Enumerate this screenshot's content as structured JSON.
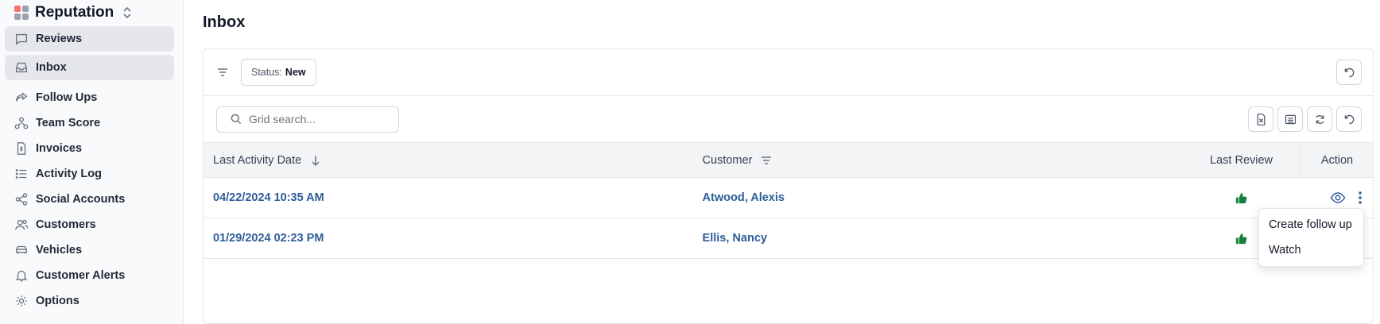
{
  "sidebar": {
    "brand": "Reputation",
    "items": [
      {
        "label": "Reviews",
        "icon": "message-square-icon",
        "active": true
      },
      {
        "label": "Inbox",
        "icon": "inbox-icon",
        "active": true
      },
      {
        "label": "Follow Ups",
        "icon": "share-icon"
      },
      {
        "label": "Team Score",
        "icon": "network-icon"
      },
      {
        "label": "Invoices",
        "icon": "file-dollar-icon"
      },
      {
        "label": "Activity Log",
        "icon": "list-icon"
      },
      {
        "label": "Social Accounts",
        "icon": "share-nodes-icon"
      },
      {
        "label": "Customers",
        "icon": "users-icon"
      },
      {
        "label": "Vehicles",
        "icon": "car-icon"
      },
      {
        "label": "Customer Alerts",
        "icon": "bell-icon"
      },
      {
        "label": "Options",
        "icon": "gear-icon"
      }
    ]
  },
  "page": {
    "title": "Inbox"
  },
  "filter": {
    "status_label": "Status:",
    "status_value": "New"
  },
  "search": {
    "placeholder": "Grid search..."
  },
  "table": {
    "columns": [
      "Last Activity Date",
      "Customer",
      "Last Review",
      "Action"
    ],
    "rows": [
      {
        "date": "04/22/2024 10:35 AM",
        "customer": "Atwood, Alexis",
        "review": "thumbs-up"
      },
      {
        "date": "01/29/2024 02:23 PM",
        "customer": "Ellis, Nancy",
        "review": "thumbs-up"
      }
    ]
  },
  "menu": {
    "items": [
      "Create follow up",
      "Watch"
    ]
  },
  "colors": {
    "link": "#2e5c99",
    "positive": "#15803d",
    "active_bg": "#e5e7eb"
  }
}
